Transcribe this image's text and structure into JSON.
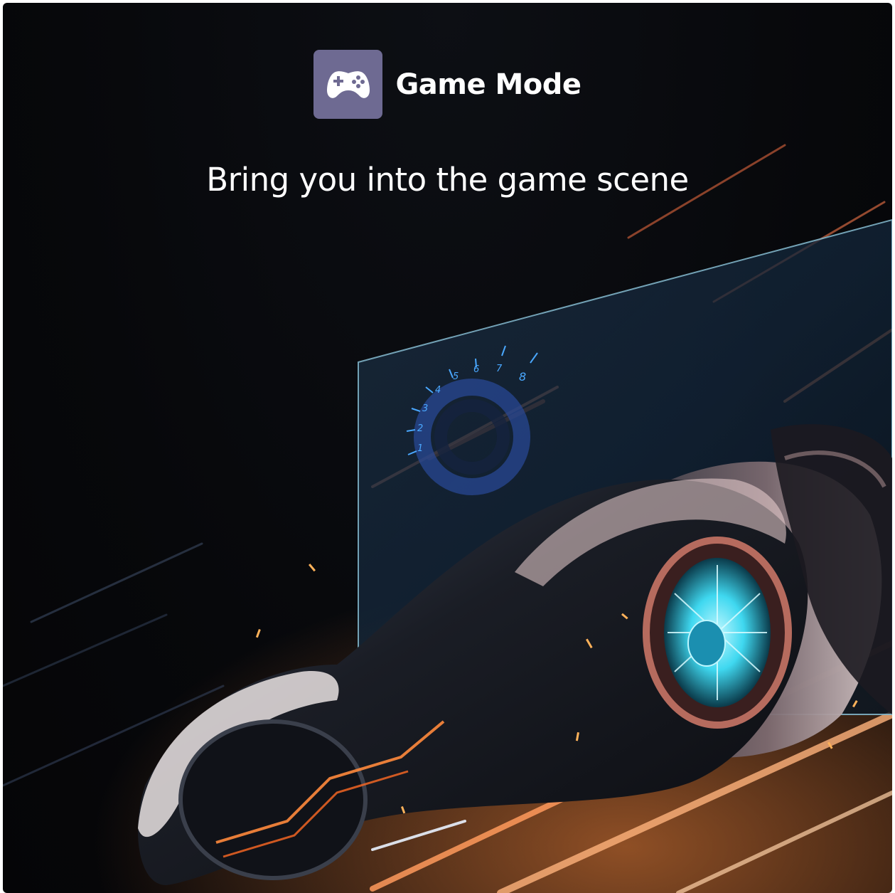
{
  "header": {
    "icon": "gamepad-icon",
    "title": "Game Mode"
  },
  "tagline": "Bring you into the game scene",
  "hero": {
    "gauge_ticks": [
      "1",
      "2",
      "3",
      "4",
      "5",
      "6",
      "7",
      "8"
    ]
  },
  "colors": {
    "background": "#07080b",
    "badge": "#6e6a92",
    "text": "#ffffff",
    "accent_orange": "#ff7a2f",
    "accent_cyan": "#3fe0ff"
  }
}
